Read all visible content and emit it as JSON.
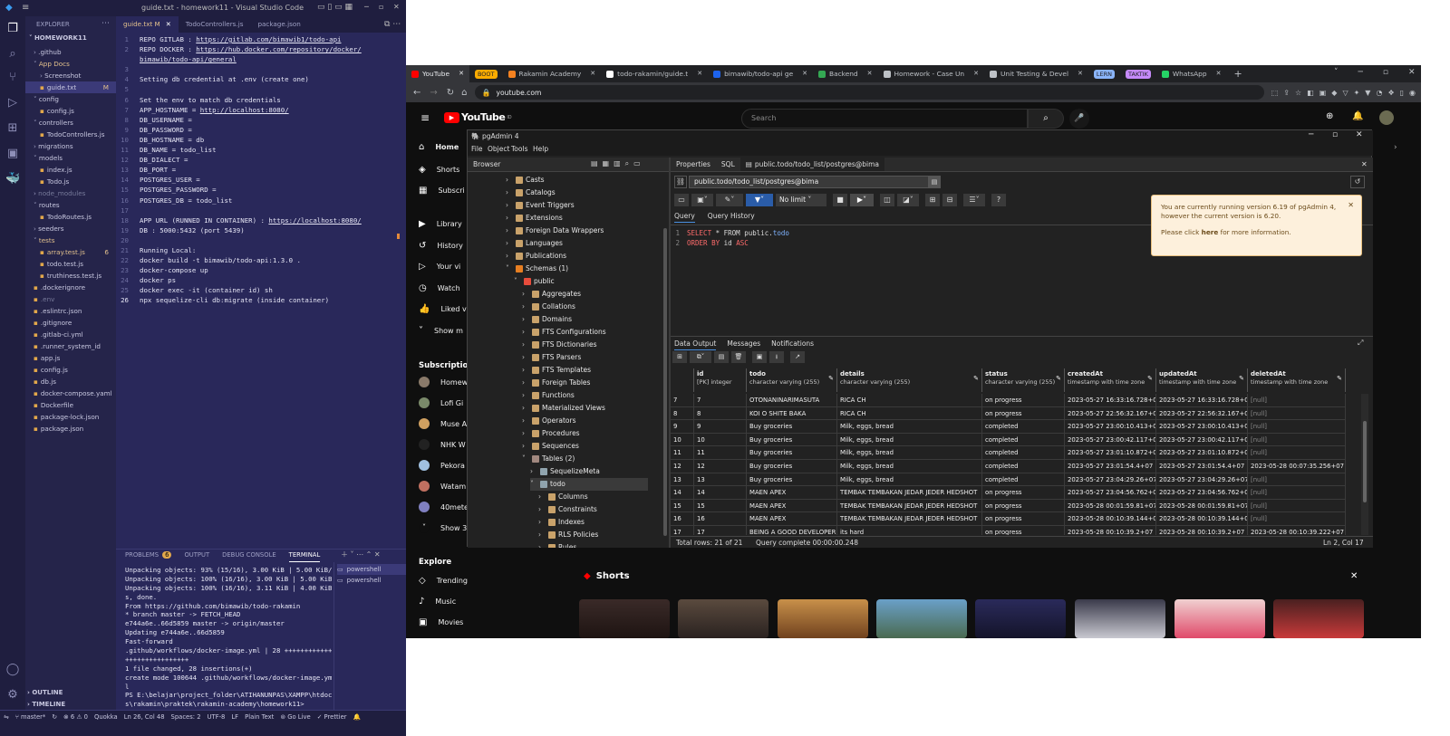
{
  "vscode": {
    "title": "guide.txt - homework11 - Visual Studio Code",
    "explorer_label": "EXPLORER",
    "root": "HOMEWORK11",
    "tree": [
      {
        "label": ".github",
        "indent": 1,
        "type": "folder"
      },
      {
        "label": "App Docs",
        "indent": 1,
        "type": "folder-open",
        "color": "#e2c08d"
      },
      {
        "label": "Screenshot",
        "indent": 2,
        "type": "folder"
      },
      {
        "label": "guide.txt",
        "indent": 2,
        "type": "file",
        "badge": "M",
        "active": true
      },
      {
        "label": "config",
        "indent": 1,
        "type": "folder-open"
      },
      {
        "label": "config.js",
        "indent": 2,
        "type": "file"
      },
      {
        "label": "controllers",
        "indent": 1,
        "type": "folder-open"
      },
      {
        "label": "TodoControllers.js",
        "indent": 2,
        "type": "file"
      },
      {
        "label": "migrations",
        "indent": 1,
        "type": "folder"
      },
      {
        "label": "models",
        "indent": 1,
        "type": "folder-open"
      },
      {
        "label": "index.js",
        "indent": 2,
        "type": "file"
      },
      {
        "label": "Todo.js",
        "indent": 2,
        "type": "file"
      },
      {
        "label": "node_modules",
        "indent": 1,
        "type": "folder",
        "dim": true
      },
      {
        "label": "routes",
        "indent": 1,
        "type": "folder-open"
      },
      {
        "label": "TodoRoutes.js",
        "indent": 2,
        "type": "file"
      },
      {
        "label": "seeders",
        "indent": 1,
        "type": "folder"
      },
      {
        "label": "tests",
        "indent": 1,
        "type": "folder-open",
        "color": "#e2c08d"
      },
      {
        "label": "array.test.js",
        "indent": 2,
        "type": "file",
        "badge": "6",
        "color": "#e2c08d"
      },
      {
        "label": "todo.test.js",
        "indent": 2,
        "type": "file"
      },
      {
        "label": "truthiness.test.js",
        "indent": 2,
        "type": "file"
      },
      {
        "label": ".dockerignore",
        "indent": 1,
        "type": "file"
      },
      {
        "label": ".env",
        "indent": 1,
        "type": "file",
        "dim": true
      },
      {
        "label": ".eslintrc.json",
        "indent": 1,
        "type": "file"
      },
      {
        "label": ".gitignore",
        "indent": 1,
        "type": "file"
      },
      {
        "label": ".gitlab-ci.yml",
        "indent": 1,
        "type": "file"
      },
      {
        "label": ".runner_system_id",
        "indent": 1,
        "type": "file"
      },
      {
        "label": "app.js",
        "indent": 1,
        "type": "file"
      },
      {
        "label": "config.js",
        "indent": 1,
        "type": "file"
      },
      {
        "label": "db.js",
        "indent": 1,
        "type": "file"
      },
      {
        "label": "docker-compose.yaml",
        "indent": 1,
        "type": "file"
      },
      {
        "label": "Dockerfile",
        "indent": 1,
        "type": "file"
      },
      {
        "label": "package-lock.json",
        "indent": 1,
        "type": "file"
      },
      {
        "label": "package.json",
        "indent": 1,
        "type": "file"
      }
    ],
    "outline": "OUTLINE",
    "timeline": "TIMELINE",
    "tabs": [
      {
        "label": "guide.txt M",
        "active": true
      },
      {
        "label": "TodoControllers.js",
        "active": false
      },
      {
        "label": "package.json",
        "active": false
      }
    ],
    "code": [
      {
        "n": "1",
        "t": "REPO GITLAB : ",
        "l": "https://gitlab.com/bimawib1/todo-api"
      },
      {
        "n": "2",
        "t": "REPO DOCKER : ",
        "l": "https://hub.docker.com/repository/docker/"
      },
      {
        "n": "",
        "t": "",
        "l": "bimawib/todo-api/general"
      },
      {
        "n": "3",
        "t": "",
        "l": ""
      },
      {
        "n": "4",
        "t": "Setting db credential at .env (create one)",
        "l": ""
      },
      {
        "n": "5",
        "t": "",
        "l": ""
      },
      {
        "n": "6",
        "t": "Set the env to match db credentials",
        "l": ""
      },
      {
        "n": "7",
        "t": "APP_HOSTNAME = ",
        "l": "http://localhost:8080/"
      },
      {
        "n": "8",
        "t": "DB_USERNAME =",
        "l": ""
      },
      {
        "n": "9",
        "t": "DB_PASSWORD =",
        "l": ""
      },
      {
        "n": "10",
        "t": "DB_HOSTNAME = db",
        "l": ""
      },
      {
        "n": "11",
        "t": "DB_NAME = todo_list",
        "l": ""
      },
      {
        "n": "12",
        "t": "DB_DIALECT =",
        "l": ""
      },
      {
        "n": "13",
        "t": "DB_PORT =",
        "l": ""
      },
      {
        "n": "14",
        "t": "POSTGRES_USER =",
        "l": ""
      },
      {
        "n": "15",
        "t": "POSTGRES_PASSWORD =",
        "l": ""
      },
      {
        "n": "16",
        "t": "POSTGRES_DB = todo_list",
        "l": ""
      },
      {
        "n": "17",
        "t": "",
        "l": ""
      },
      {
        "n": "18",
        "t": "APP URL (RUNNED IN CONTAINER) : ",
        "l": "https://localhost:8080/"
      },
      {
        "n": "19",
        "t": "DB : 5000:5432 (port 5439)",
        "l": ""
      },
      {
        "n": "20",
        "t": "",
        "l": ""
      },
      {
        "n": "21",
        "t": "Running Local:",
        "l": ""
      },
      {
        "n": "22",
        "t": "docker build -t bimawib/todo-api:1.3.0 .",
        "l": ""
      },
      {
        "n": "23",
        "t": "docker-compose up",
        "l": ""
      },
      {
        "n": "24",
        "t": "docker ps",
        "l": ""
      },
      {
        "n": "25",
        "t": "docker exec -it (container id) sh",
        "l": ""
      },
      {
        "n": "26",
        "t": "npx sequelize-cli db:migrate (inside container)",
        "l": ""
      }
    ],
    "panel_tabs": [
      "PROBLEMS",
      "OUTPUT",
      "DEBUG CONSOLE",
      "TERMINAL"
    ],
    "problems_count": "6",
    "terminal": [
      "Unpacking objects:  93% (15/16), 3.00 KiB | 5.00 KiB/",
      "Unpacking objects: 100% (16/16), 3.00 KiB | 5.00 KiB/",
      "Unpacking objects: 100% (16/16), 3.11 KiB | 4.00 KiB/",
      "s, done.",
      "From https://github.com/bimawib/todo-rakamin",
      " * branch            master     -> FETCH_HEAD",
      "   e744a6e..66d5859  master     -> origin/master",
      "Updating e744a6e..66d5859",
      "Fast-forward",
      " .github/workflows/docker-image.yml | 28 ++++++++++++",
      "++++++++++++++++",
      " 1 file changed, 28 insertions(+)",
      " create mode 100644 .github/workflows/docker-image.ym",
      "l",
      "PS E:\\belajar\\project_folder\\ATIHANUNPAS\\XAMPP\\htdoc",
      "s\\rakamin\\praktek\\rakamin-academy\\homework11> "
    ],
    "shells": [
      "powershell",
      "powershell"
    ],
    "status": {
      "branch": "master*",
      "errors": "6",
      "warnings": "0",
      "quokka": "Quokka",
      "cursor": "Ln 26, Col 48",
      "spaces": "Spaces: 2",
      "encoding": "UTF-8",
      "eol": "LF",
      "lang": "Plain Text",
      "golive": "Go Live",
      "prettier": "Prettier"
    }
  },
  "chrome": {
    "tabs": [
      {
        "label": "YouTube",
        "active": true,
        "icon": "youtube-icon",
        "color": "#ff0000"
      },
      {
        "label": "BOOT",
        "chip": true,
        "color": "#f9ab00"
      },
      {
        "label": "Rakamin Academy",
        "icon": "rakamin-icon",
        "color": "#f58220"
      },
      {
        "label": "todo-rakamin/guide.t",
        "icon": "github-icon",
        "color": "#ffffff"
      },
      {
        "label": "bimawib/todo-api ge",
        "icon": "docker-icon",
        "color": "#1d63ed"
      },
      {
        "label": "Backend",
        "icon": "doc-icon",
        "color": "#34a853"
      },
      {
        "label": "Homework - Case Un",
        "icon": "globe-icon",
        "color": "#bdc1c6"
      },
      {
        "label": "Unit Testing & Devel",
        "icon": "globe-icon",
        "color": "#bdc1c6"
      },
      {
        "label": "LERN",
        "chip": true,
        "color": "#8ab4f8"
      },
      {
        "label": "TAKTIK",
        "chip": true,
        "color": "#c58af9"
      },
      {
        "label": "WhatsApp",
        "icon": "whatsapp-icon",
        "color": "#25d366"
      }
    ],
    "url": "youtube.com",
    "youtube": {
      "logo": "YouTube",
      "country": "ID",
      "search_placeholder": "Search",
      "side": [
        {
          "label": "Home",
          "icon": "home-icon"
        },
        {
          "label": "Shorts",
          "icon": "shorts-icon"
        },
        {
          "label": "Subscri",
          "icon": "subscriptions-icon"
        },
        {
          "label": "Library",
          "icon": "library-icon"
        },
        {
          "label": "History",
          "icon": "history-icon"
        },
        {
          "label": "Your vi",
          "icon": "your-videos-icon"
        },
        {
          "label": "Watch",
          "icon": "watch-later-icon"
        },
        {
          "label": "Liked v",
          "icon": "liked-icon"
        },
        {
          "label": "Show m",
          "icon": "chevron-down-icon"
        }
      ],
      "subscriptions_title": "Subscription",
      "subs": [
        "Homew",
        "Lofi Gi",
        "Muse A",
        "NHK W",
        "Pekora",
        "Watam",
        "40mete",
        "Show 3"
      ],
      "explore_title": "Explore",
      "explore": [
        {
          "label": "Trending",
          "icon": "trending-icon"
        },
        {
          "label": "Music",
          "icon": "music-icon"
        },
        {
          "label": "Movies",
          "icon": "movies-icon"
        }
      ],
      "shorts_title": "Shorts"
    }
  },
  "pgadmin": {
    "title": "pgAdmin 4",
    "menu": [
      "File",
      "Object",
      "Tools",
      "Help"
    ],
    "browser_label": "Browser",
    "tree": [
      {
        "label": "Casts",
        "lvl": 4,
        "icon": "casts-icon"
      },
      {
        "label": "Catalogs",
        "lvl": 4,
        "icon": "catalogs-icon"
      },
      {
        "label": "Event Triggers",
        "lvl": 4,
        "icon": "event-triggers-icon"
      },
      {
        "label": "Extensions",
        "lvl": 4,
        "icon": "extensions-icon"
      },
      {
        "label": "Foreign Data Wrappers",
        "lvl": 4,
        "icon": "fdw-icon"
      },
      {
        "label": "Languages",
        "lvl": 4,
        "icon": "languages-icon"
      },
      {
        "label": "Publications",
        "lvl": 4,
        "icon": "publications-icon"
      },
      {
        "label": "Schemas (1)",
        "lvl": 4,
        "open": true,
        "icon": "schemas-icon"
      },
      {
        "label": "public",
        "lvl": 5,
        "open": true,
        "icon": "schema-icon"
      },
      {
        "label": "Aggregates",
        "lvl": 6,
        "icon": "aggregates-icon"
      },
      {
        "label": "Collations",
        "lvl": 6,
        "icon": "collations-icon"
      },
      {
        "label": "Domains",
        "lvl": 6,
        "icon": "domains-icon"
      },
      {
        "label": "FTS Configurations",
        "lvl": 6,
        "icon": "fts-config-icon"
      },
      {
        "label": "FTS Dictionaries",
        "lvl": 6,
        "icon": "fts-dict-icon"
      },
      {
        "label": "FTS Parsers",
        "lvl": 6,
        "icon": "fts-parser-icon"
      },
      {
        "label": "FTS Templates",
        "lvl": 6,
        "icon": "fts-templates-icon"
      },
      {
        "label": "Foreign Tables",
        "lvl": 6,
        "icon": "foreign-tables-icon"
      },
      {
        "label": "Functions",
        "lvl": 6,
        "icon": "functions-icon"
      },
      {
        "label": "Materialized Views",
        "lvl": 6,
        "icon": "mviews-icon"
      },
      {
        "label": "Operators",
        "lvl": 6,
        "icon": "operators-icon"
      },
      {
        "label": "Procedures",
        "lvl": 6,
        "icon": "procedures-icon"
      },
      {
        "label": "Sequences",
        "lvl": 6,
        "icon": "sequences-icon"
      },
      {
        "label": "Tables (2)",
        "lvl": 6,
        "open": true,
        "icon": "tables-icon"
      },
      {
        "label": "SequelizeMeta",
        "lvl": 7,
        "icon": "table-icon"
      },
      {
        "label": "todo",
        "lvl": 7,
        "open": true,
        "selected": true,
        "icon": "table-icon"
      },
      {
        "label": "Columns",
        "lvl": 8,
        "icon": "columns-icon"
      },
      {
        "label": "Constraints",
        "lvl": 8,
        "icon": "constraints-icon"
      },
      {
        "label": "Indexes",
        "lvl": 8,
        "icon": "indexes-icon"
      },
      {
        "label": "RLS Policies",
        "lvl": 8,
        "icon": "rls-icon"
      },
      {
        "label": "Rules",
        "lvl": 8,
        "icon": "rules-icon"
      }
    ],
    "right_tabs": [
      "Properties",
      "SQL",
      "public.todo/todo_list/postgres@bima"
    ],
    "connection": "public.todo/todo_list/postgres@bima",
    "limit": "No limit",
    "query_tabs": [
      "Query",
      "Query History"
    ],
    "sql": [
      {
        "n": "1",
        "kw1": "SELECT",
        "rest": " * FROM public.",
        "obj": "todo"
      },
      {
        "n": "2",
        "kw1": "ORDER BY",
        "rest": " id ",
        "obj": "",
        "kw2": "ASC"
      }
    ],
    "notice": {
      "line1": "You are currently running version 6.19 of pgAdmin 4,",
      "line2": "however the current version is 6.20.",
      "pre": "Please click ",
      "link": "here",
      "post": " for more information."
    },
    "output_tabs": [
      "Data Output",
      "Messages",
      "Notifications"
    ],
    "columns": [
      {
        "name": "id",
        "type": "[PK] integer"
      },
      {
        "name": "todo",
        "type": "character varying (255)"
      },
      {
        "name": "details",
        "type": "character varying (255)"
      },
      {
        "name": "status",
        "type": "character varying (255)"
      },
      {
        "name": "createdAt",
        "type": "timestamp with time zone"
      },
      {
        "name": "updatedAt",
        "type": "timestamp with time zone"
      },
      {
        "name": "deletedAt",
        "type": "timestamp with time zone"
      }
    ],
    "rows": [
      [
        "7",
        "7",
        "OTONANINARIMASUTA",
        "RICA CH",
        "on progress",
        "2023-05-27 16:33:16.728+07",
        "2023-05-27 16:33:16.728+07",
        "[null]"
      ],
      [
        "8",
        "8",
        "KOI O SHITE BAKA",
        "RICA CH",
        "on progress",
        "2023-05-27 22:56:32.167+07",
        "2023-05-27 22:56:32.167+07",
        "[null]"
      ],
      [
        "9",
        "9",
        "Buy groceries",
        "Milk, eggs, bread",
        "completed",
        "2023-05-27 23:00:10.413+07",
        "2023-05-27 23:00:10.413+07",
        "[null]"
      ],
      [
        "10",
        "10",
        "Buy groceries",
        "Milk, eggs, bread",
        "completed",
        "2023-05-27 23:00:42.117+07",
        "2023-05-27 23:00:42.117+07",
        "[null]"
      ],
      [
        "11",
        "11",
        "Buy groceries",
        "Milk, eggs, bread",
        "completed",
        "2023-05-27 23:01:10.872+07",
        "2023-05-27 23:01:10.872+07",
        "[null]"
      ],
      [
        "12",
        "12",
        "Buy groceries",
        "Milk, eggs, bread",
        "completed",
        "2023-05-27 23:01:54.4+07",
        "2023-05-27 23:01:54.4+07",
        "2023-05-28 00:07:35.256+07"
      ],
      [
        "13",
        "13",
        "Buy groceries",
        "Milk, eggs, bread",
        "completed",
        "2023-05-27 23:04:29.26+07",
        "2023-05-27 23:04:29.26+07",
        "[null]"
      ],
      [
        "14",
        "14",
        "MAEN APEX",
        "TEMBAK TEMBAKAN JEDAR JEDER HEDSHOT",
        "on progress",
        "2023-05-27 23:04:56.762+07",
        "2023-05-27 23:04:56.762+07",
        "[null]"
      ],
      [
        "15",
        "15",
        "MAEN APEX",
        "TEMBAK TEMBAKAN JEDAR JEDER HEDSHOT",
        "on progress",
        "2023-05-28 00:01:59.81+07",
        "2023-05-28 00:01:59.81+07",
        "[null]"
      ],
      [
        "16",
        "16",
        "MAEN APEX",
        "TEMBAK TEMBAKAN JEDAR JEDER HEDSHOT",
        "on progress",
        "2023-05-28 00:10:39.144+07",
        "2023-05-28 00:10:39.144+07",
        "[null]"
      ],
      [
        "17",
        "17",
        "BEING A GOOD DEVELOPER",
        "its hard",
        "on progress",
        "2023-05-28 00:10:39.2+07",
        "2023-05-28 00:10:39.2+07",
        "2023-05-28 00:10:39.222+07"
      ]
    ],
    "total_rows": "Total rows: 21 of 21",
    "query_status": "Query complete 00:00:00.248",
    "cursor": "Ln 2, Col 17"
  }
}
